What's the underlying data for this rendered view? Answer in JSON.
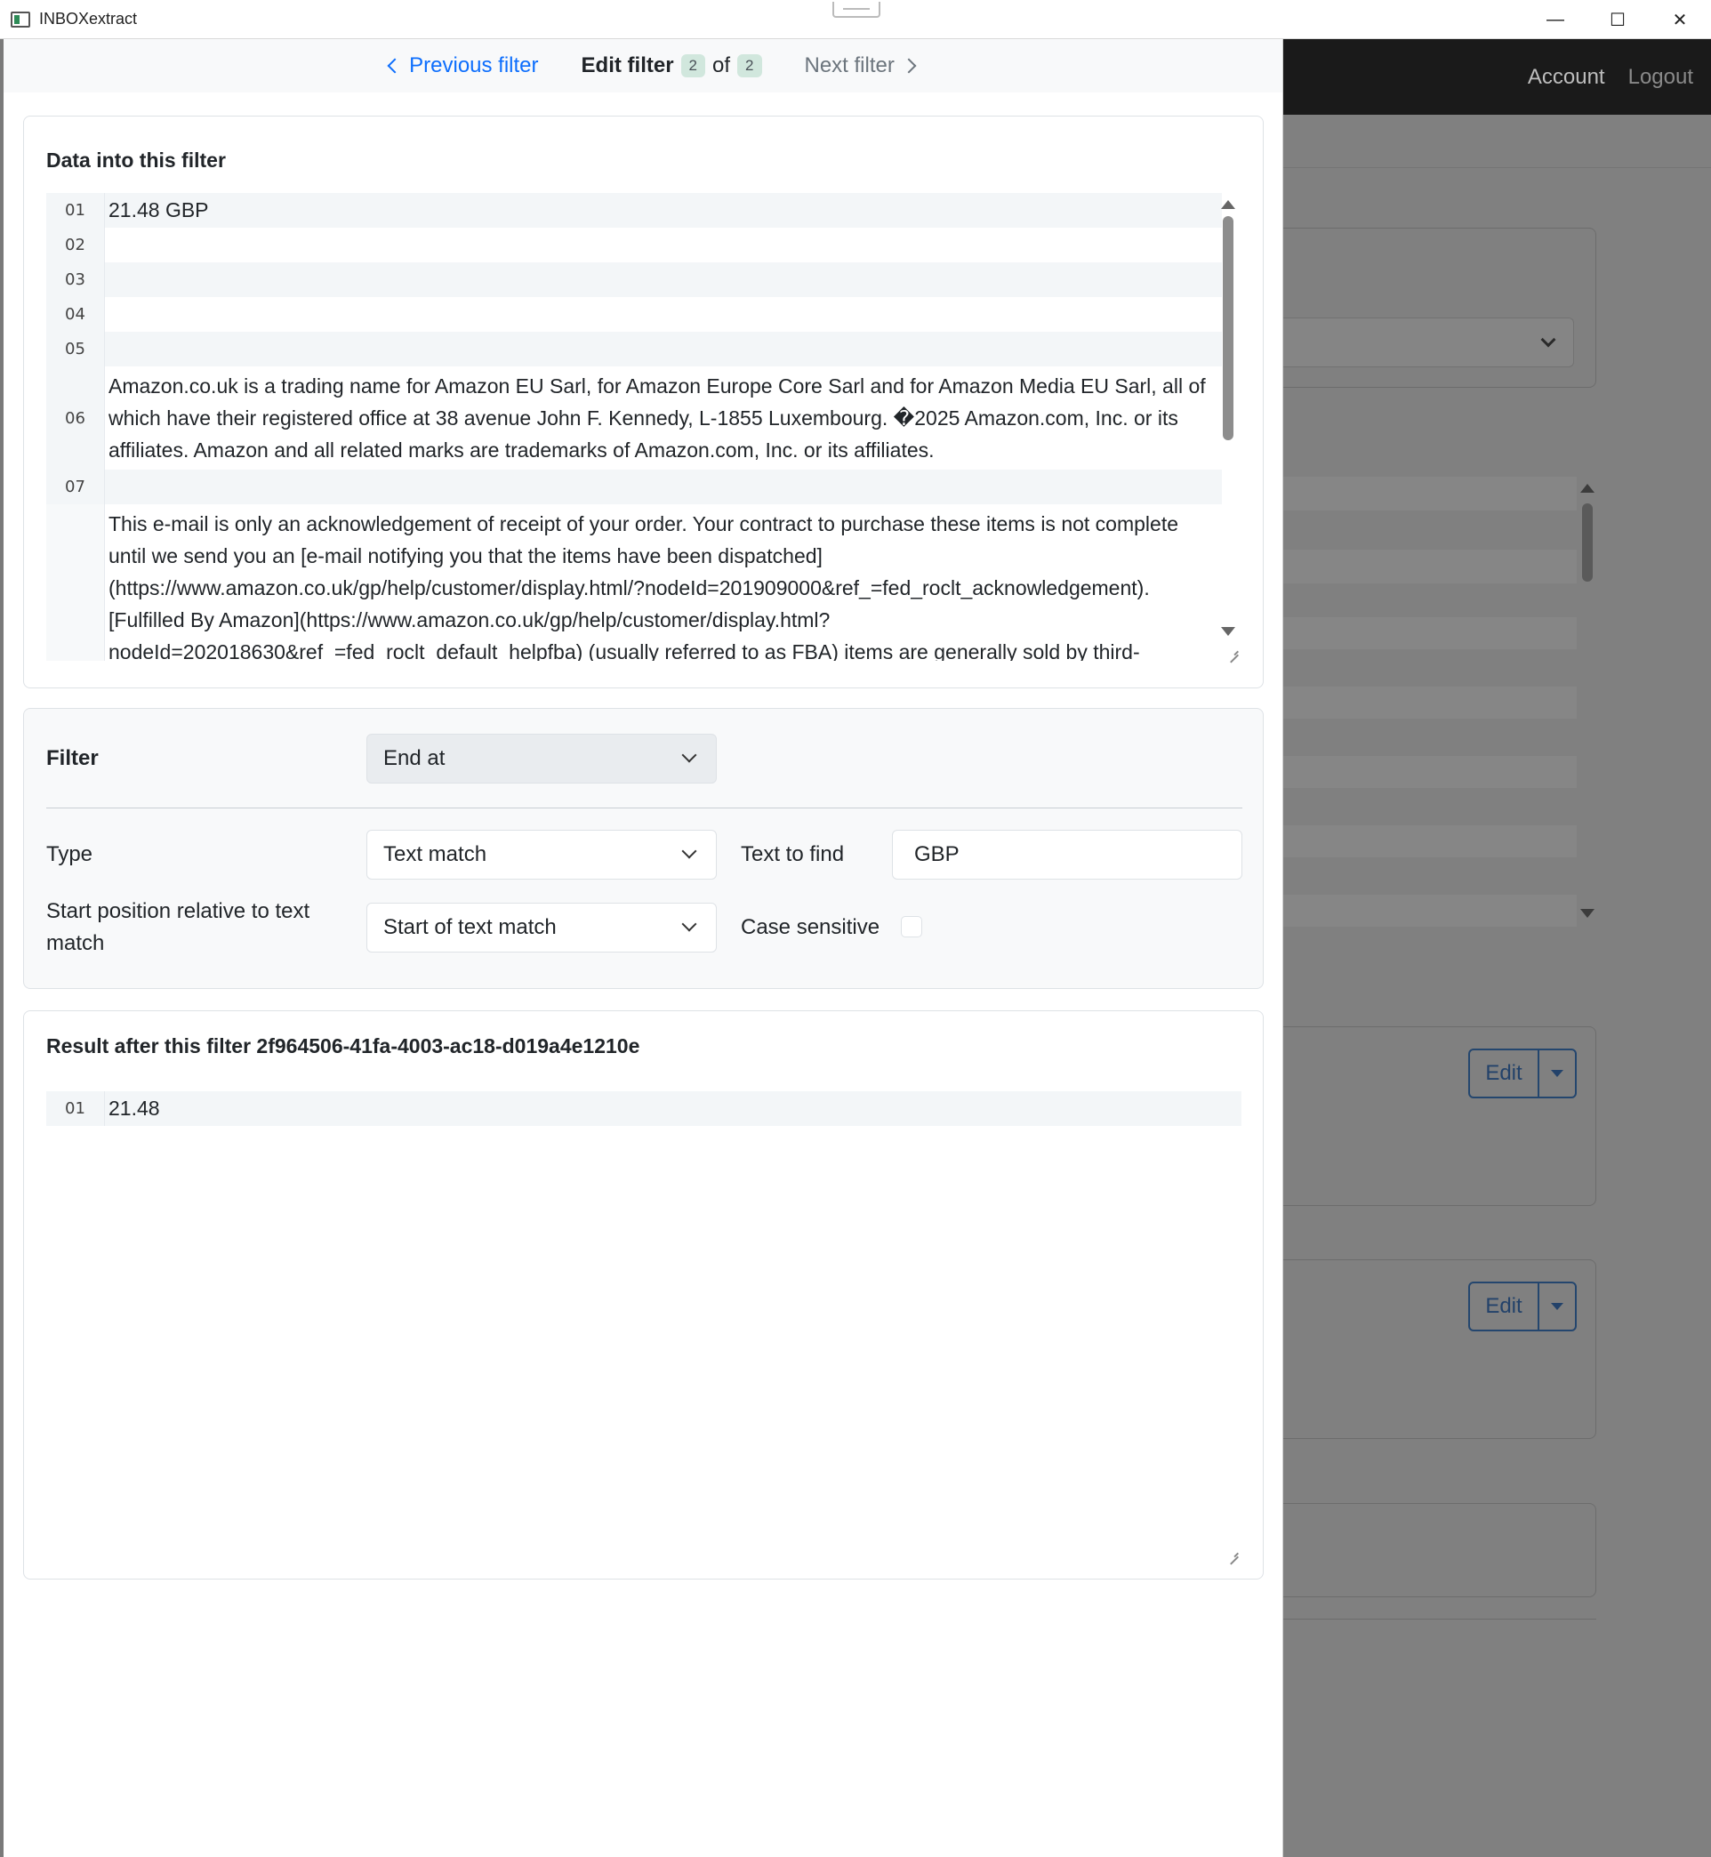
{
  "window": {
    "title": "INBOXextract",
    "minimize_glyph": "—",
    "maximize_glyph": "☐",
    "close_glyph": "✕"
  },
  "header": {
    "prev_label": "Previous filter",
    "edit_label": "Edit filter",
    "current_index": "2",
    "of_label": "of",
    "total": "2",
    "next_label": "Next filter"
  },
  "data_panel": {
    "title": "Data into this filter",
    "lines": [
      {
        "num": "01",
        "text": "21.48 GBP"
      },
      {
        "num": "02",
        "text": ""
      },
      {
        "num": "03",
        "text": ""
      },
      {
        "num": "04",
        "text": ""
      },
      {
        "num": "05",
        "text": ""
      },
      {
        "num": "06",
        "text": "Amazon.co.uk is a trading name for Amazon EU Sarl, for Amazon Europe Core Sarl and for Amazon Media EU Sarl, all of which have their registered office at 38 avenue John F. Kennedy, L-1855 Luxembourg. �2025 Amazon.com, Inc. or its affiliates. Amazon and all related marks are trademarks of Amazon.com, Inc. or its affiliates."
      },
      {
        "num": "07",
        "text": ""
      },
      {
        "num": "",
        "text": "This e-mail is only an acknowledgement of receipt of your order. Your contract to purchase these items is not complete until we send you an [e-mail notifying you that the items have been dispatched](https://www.amazon.co.uk/gp/help/customer/display.html/?nodeId=201909000&ref_=fed_roclt_acknowledgement). [Fulfilled By Amazon](https://www.amazon.co.uk/gp/help/customer/display.html?nodeId=202018630&ref_=fed_roclt_default_helpfba) (usually referred to as FBA) items are generally sold by third-"
      }
    ]
  },
  "filter_form": {
    "filter_label": "Filter",
    "filter_value": "End at",
    "type_label": "Type",
    "type_value": "Text match",
    "text_to_find_label": "Text to find",
    "text_to_find_value": "GBP",
    "start_position_label": "Start position relative to text match",
    "start_position_value": "Start of text match",
    "case_sensitive_label": "Case sensitive",
    "case_sensitive_checked": false
  },
  "result_panel": {
    "title": "Result after this filter 2f964506-41fa-4003-ac18-d019a4e1210e",
    "lines": [
      {
        "num": "01",
        "text": "21.48"
      }
    ]
  },
  "background_page": {
    "nav_account": "Account",
    "nav_logout": "Logout",
    "edit_label_1": "Edit",
    "edit_label_2": "Edit"
  }
}
